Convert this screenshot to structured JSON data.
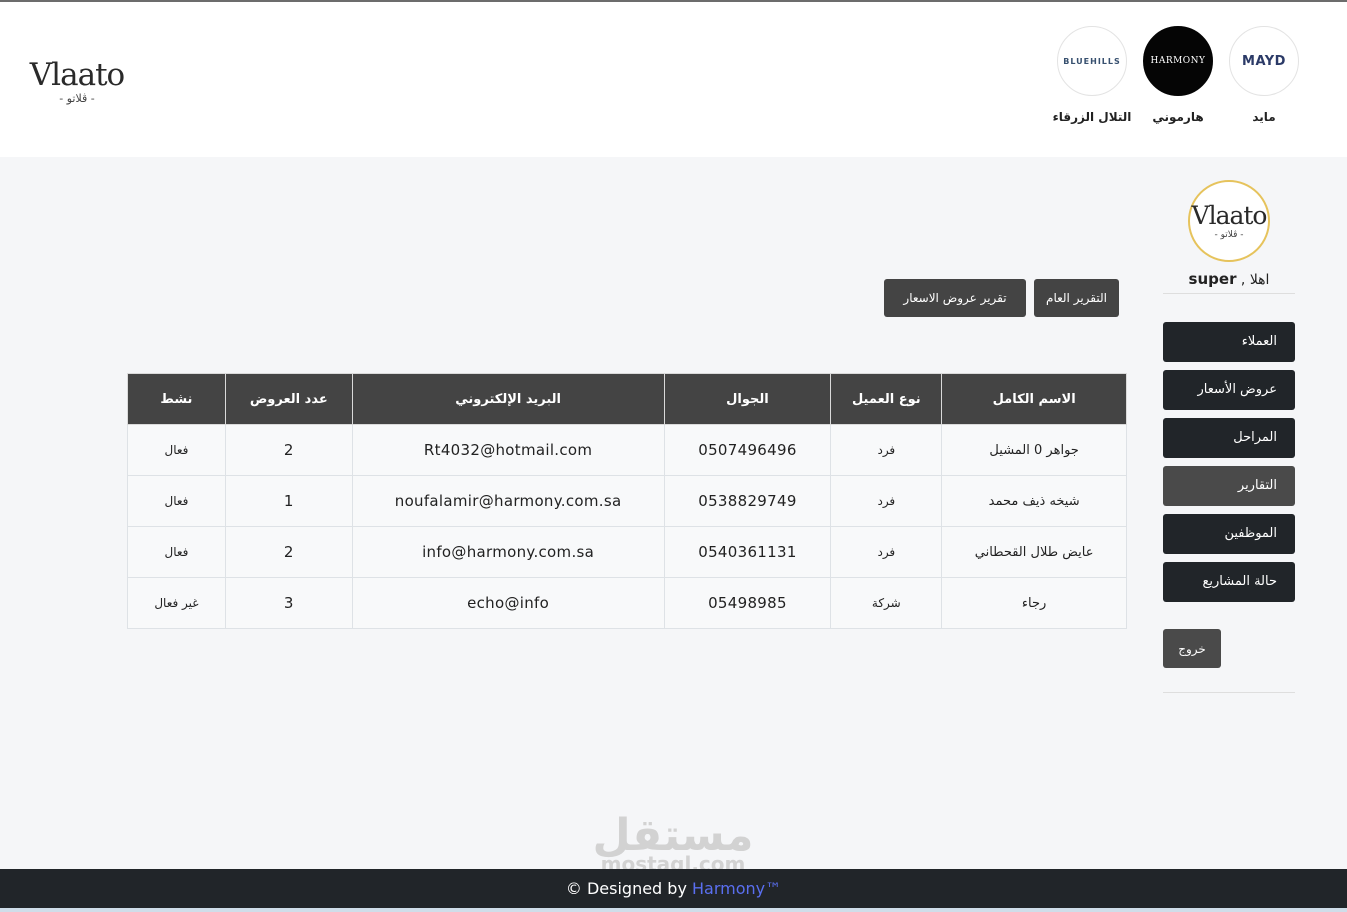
{
  "header": {
    "brand": {
      "main": "Vlaato",
      "sub": "- ڤلاتو -"
    },
    "partners": [
      {
        "logo_text": "BLUEHILLS",
        "name": "التلال الزرقاء"
      },
      {
        "logo_text": "HARMONY",
        "name": "هارموني"
      },
      {
        "logo_text": "MAYD",
        "name": "مايد"
      }
    ]
  },
  "sidebar": {
    "logo_main": "Vlaato",
    "logo_sub": "- ڤلاتو -",
    "greeting_prefix": "اهلا ,",
    "username": "super",
    "nav": [
      {
        "label": "العملاء"
      },
      {
        "label": "عروض الأسعار"
      },
      {
        "label": "المراحل"
      },
      {
        "label": "التقارير"
      },
      {
        "label": "الموظفين"
      },
      {
        "label": "حالة المشاريع"
      }
    ],
    "logout_label": "خروج"
  },
  "reports": {
    "general_label": "التقرير العام",
    "quotes_label": "تقرير عروض الاسعار"
  },
  "table": {
    "headers": [
      "الاسم الكامل",
      "نوع العميل",
      "الجوال",
      "البريد الإلكتروني",
      "عدد العروض",
      "نشط"
    ],
    "rows": [
      {
        "name": "جواهر 0 المشيل",
        "type": "فرد",
        "phone": "0507496496",
        "email": "Rt4032@hotmail.com",
        "offers": "2",
        "status": "فعال"
      },
      {
        "name": "شيخه ذيف محمد",
        "type": "فرد",
        "phone": "0538829749",
        "email": "noufalamir@harmony.com.sa",
        "offers": "1",
        "status": "فعال"
      },
      {
        "name": "عايض طلال القحطاني",
        "type": "فرد",
        "phone": "0540361131",
        "email": "info@harmony.com.sa",
        "offers": "2",
        "status": "فعال"
      },
      {
        "name": "رجاء",
        "type": "شركة",
        "phone": "05498985",
        "email": "echo@info",
        "offers": "3",
        "status": "غير فعال"
      }
    ]
  },
  "watermark": {
    "ar": "مستقل",
    "en": "mostaql.com"
  },
  "footer": {
    "text": "© Designed by ",
    "link": "Harmony™"
  }
}
